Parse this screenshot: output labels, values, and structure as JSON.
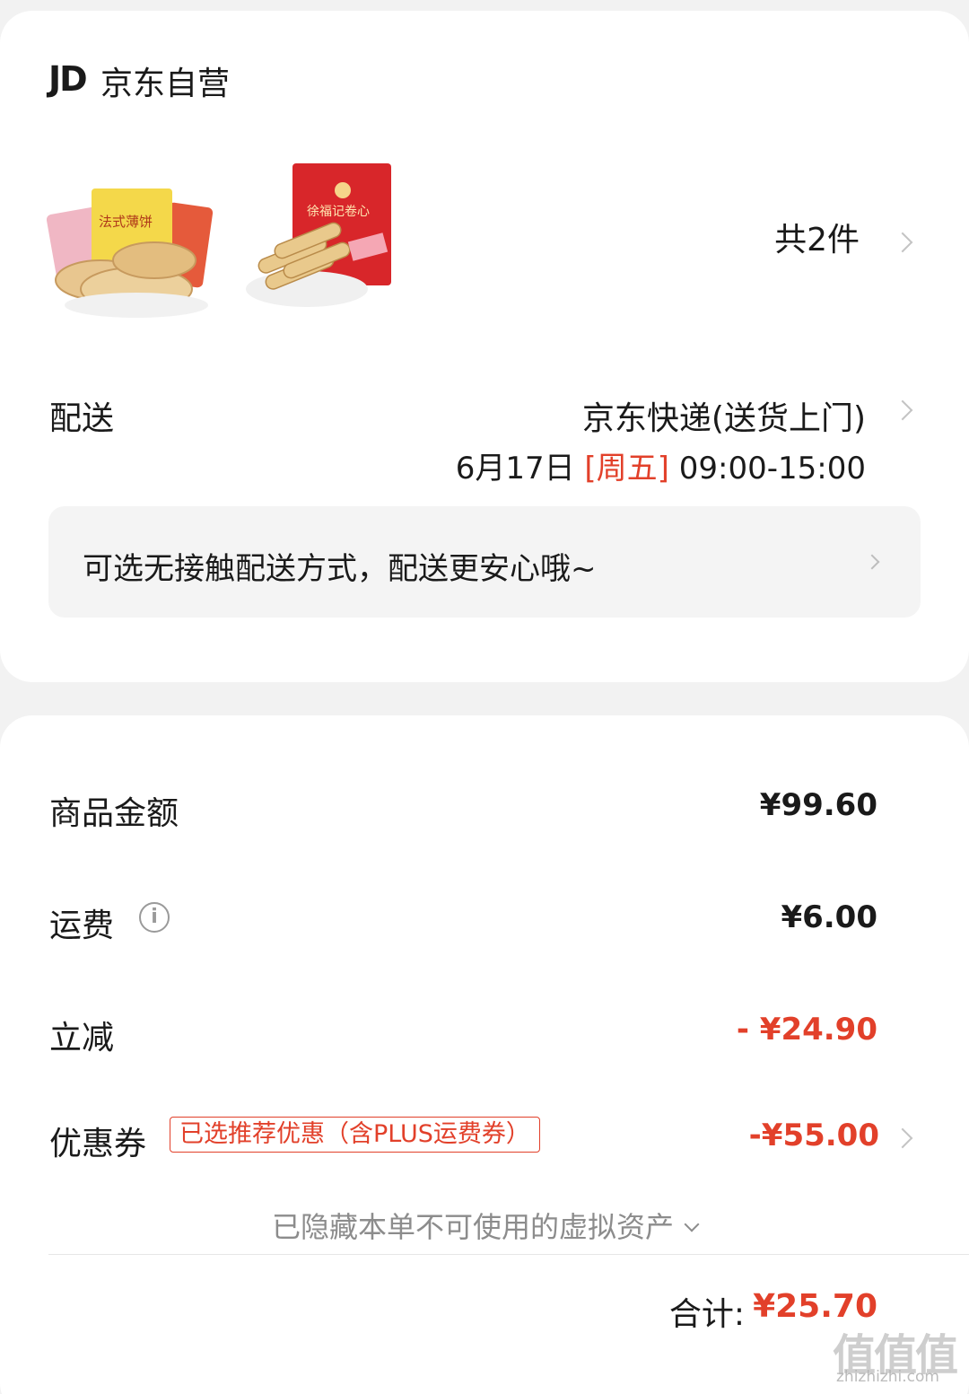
{
  "store": {
    "logo_text": "JD",
    "name": "京东自营"
  },
  "items": {
    "count_label": "共2件",
    "thumbnails": [
      {
        "icon": "wafer-biscuit-product-image",
        "package_text": "法式薄饼"
      },
      {
        "icon": "egg-roll-product-image",
        "package_text": "徐福记卷心"
      }
    ]
  },
  "delivery": {
    "label": "配送",
    "method": "京东快递(送货上门)",
    "date": "6月17日",
    "weekday": "[周五]",
    "time_range": "09:00-15:00"
  },
  "contactless": {
    "text": "可选无接触配送方式，配送更安心哦~"
  },
  "pricing": {
    "goods_label": "商品金额",
    "goods_value": "¥99.60",
    "shipping_label": "运费",
    "shipping_value": "¥6.00",
    "discount_label": "立减",
    "discount_value": "- ¥24.90",
    "coupon_label": "优惠券",
    "coupon_tag": "已选推荐优惠（含PLUS运费券）",
    "coupon_value": "-¥55.00",
    "hidden_assets_text": "已隐藏本单不可使用的虚拟资产",
    "total_label": "合计:",
    "total_value": "¥25.70"
  },
  "watermark": {
    "glyphs": "值值值",
    "url": "zhizhizhi.com"
  },
  "colors": {
    "accent_red": "#e2402a",
    "background": "#f2f2f2",
    "card": "#ffffff"
  }
}
